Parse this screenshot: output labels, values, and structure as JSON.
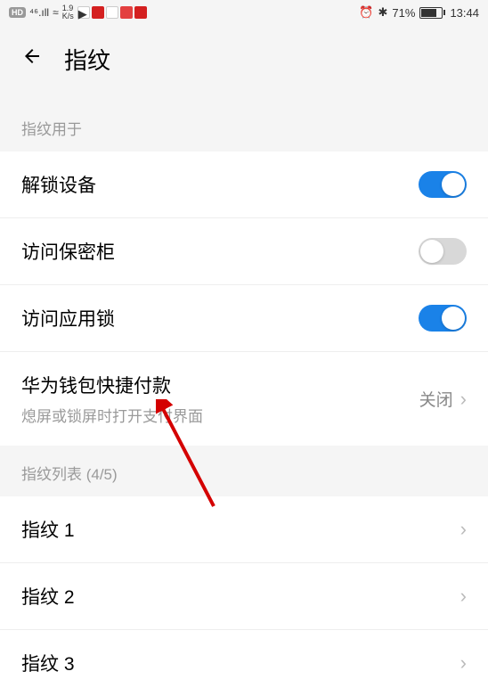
{
  "status": {
    "hd": "HD",
    "signal": "⁴⁶.ıll",
    "wifi": "≈",
    "speed_top": "1.9",
    "speed_bottom": "K/s",
    "alarm": "⏰",
    "bt": "✱",
    "battery_pct": "71%",
    "time": "13:44"
  },
  "header": {
    "title": "指纹"
  },
  "sections": {
    "usedfor": "指纹用于",
    "list_header": "指纹列表 (4/5)"
  },
  "items": {
    "unlock": "解锁设备",
    "vault": "访问保密柜",
    "applock": "访问应用锁",
    "wallet": "华为钱包快捷付款",
    "wallet_sub": "熄屏或锁屏时打开支付界面",
    "wallet_state": "关闭",
    "fp1": "指纹 1",
    "fp2": "指纹 2",
    "fp3": "指纹 3"
  }
}
